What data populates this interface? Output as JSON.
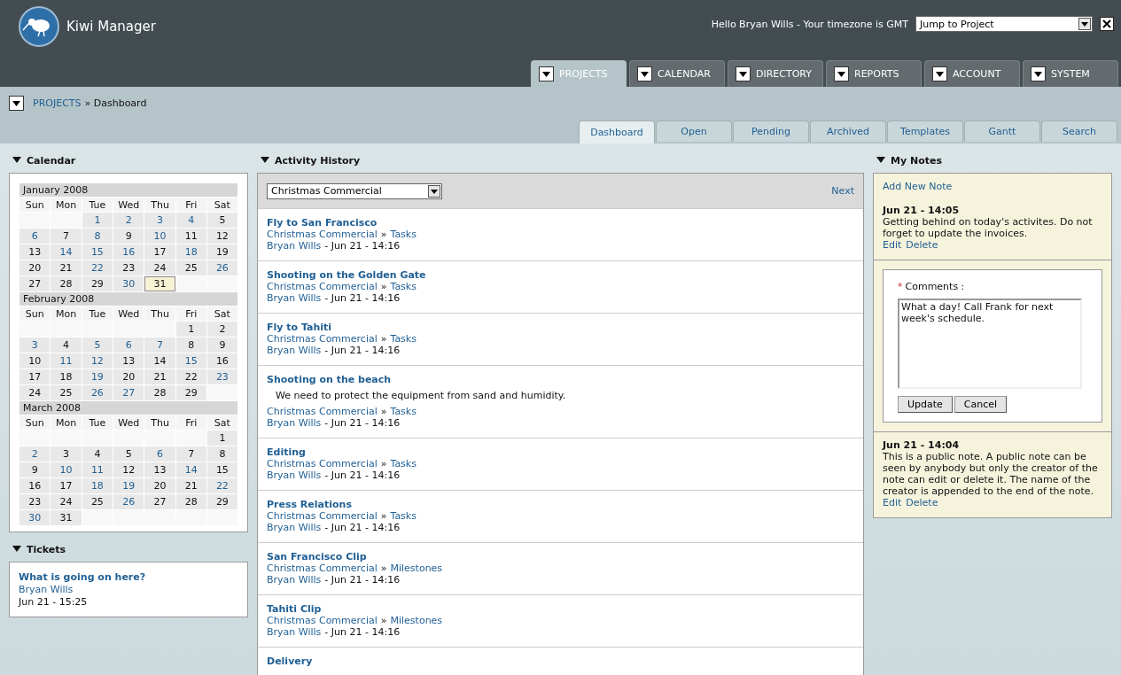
{
  "header": {
    "app_name": "Kiwi Manager",
    "greeting": "Hello Bryan Wills - Your timezone is GMT",
    "jump_select": {
      "value": "Jump to Project"
    }
  },
  "main_tabs": [
    {
      "label": "PROJECTS",
      "selected": true
    },
    {
      "label": "CALENDAR",
      "selected": false
    },
    {
      "label": "DIRECTORY",
      "selected": false
    },
    {
      "label": "REPORTS",
      "selected": false
    },
    {
      "label": "ACCOUNT",
      "selected": false
    },
    {
      "label": "SYSTEM",
      "selected": false
    }
  ],
  "breadcrumb": {
    "link": "PROJECTS",
    "current": "» Dashboard"
  },
  "sub_tabs": [
    {
      "label": "Dashboard",
      "selected": true
    },
    {
      "label": "Open",
      "selected": false
    },
    {
      "label": "Pending",
      "selected": false
    },
    {
      "label": "Archived",
      "selected": false
    },
    {
      "label": "Templates",
      "selected": false
    },
    {
      "label": "Gantt",
      "selected": false
    },
    {
      "label": "Search",
      "selected": false
    }
  ],
  "calendar": {
    "title": "Calendar",
    "months": [
      {
        "name": "January 2008",
        "weekdays": [
          "Sun",
          "Mon",
          "Tue",
          "Wed",
          "Thu",
          "Fri",
          "Sat"
        ],
        "weeks": [
          [
            {
              "kind": "empty"
            },
            {
              "kind": "empty"
            },
            {
              "kind": "day",
              "d": "1",
              "link": true,
              "selected": false
            },
            {
              "kind": "day",
              "d": "2",
              "link": true,
              "selected": false
            },
            {
              "kind": "day",
              "d": "3",
              "link": true,
              "selected": false
            },
            {
              "kind": "day",
              "d": "4",
              "link": true,
              "selected": false
            },
            {
              "kind": "day",
              "d": "5",
              "link": false,
              "selected": false
            }
          ],
          [
            {
              "kind": "day",
              "d": "6",
              "link": true,
              "selected": false
            },
            {
              "kind": "day",
              "d": "7",
              "link": false,
              "selected": false
            },
            {
              "kind": "day",
              "d": "8",
              "link": true,
              "selected": false
            },
            {
              "kind": "day",
              "d": "9",
              "link": false,
              "selected": false
            },
            {
              "kind": "day",
              "d": "10",
              "link": true,
              "selected": false
            },
            {
              "kind": "day",
              "d": "11",
              "link": false,
              "selected": false
            },
            {
              "kind": "day",
              "d": "12",
              "link": false,
              "selected": false
            }
          ],
          [
            {
              "kind": "day",
              "d": "13",
              "link": false,
              "selected": false
            },
            {
              "kind": "day",
              "d": "14",
              "link": true,
              "selected": false
            },
            {
              "kind": "day",
              "d": "15",
              "link": true,
              "selected": false
            },
            {
              "kind": "day",
              "d": "16",
              "link": true,
              "selected": false
            },
            {
              "kind": "day",
              "d": "17",
              "link": false,
              "selected": false
            },
            {
              "kind": "day",
              "d": "18",
              "link": true,
              "selected": false
            },
            {
              "kind": "day",
              "d": "19",
              "link": false,
              "selected": false
            }
          ],
          [
            {
              "kind": "day",
              "d": "20",
              "link": false,
              "selected": false
            },
            {
              "kind": "day",
              "d": "21",
              "link": false,
              "selected": false
            },
            {
              "kind": "day",
              "d": "22",
              "link": true,
              "selected": false
            },
            {
              "kind": "day",
              "d": "23",
              "link": false,
              "selected": false
            },
            {
              "kind": "day",
              "d": "24",
              "link": false,
              "selected": false
            },
            {
              "kind": "day",
              "d": "25",
              "link": false,
              "selected": false
            },
            {
              "kind": "day",
              "d": "26",
              "link": true,
              "selected": false
            }
          ],
          [
            {
              "kind": "day",
              "d": "27",
              "link": false,
              "selected": false
            },
            {
              "kind": "day",
              "d": "28",
              "link": false,
              "selected": false
            },
            {
              "kind": "day",
              "d": "29",
              "link": false,
              "selected": false
            },
            {
              "kind": "day",
              "d": "30",
              "link": true,
              "selected": false
            },
            {
              "kind": "day",
              "d": "31",
              "link": false,
              "selected": true
            },
            {
              "kind": "empty"
            },
            {
              "kind": "empty"
            }
          ]
        ]
      },
      {
        "name": "February 2008",
        "weekdays": [
          "Sun",
          "Mon",
          "Tue",
          "Wed",
          "Thu",
          "Fri",
          "Sat"
        ],
        "weeks": [
          [
            {
              "kind": "empty"
            },
            {
              "kind": "empty"
            },
            {
              "kind": "empty"
            },
            {
              "kind": "empty"
            },
            {
              "kind": "empty"
            },
            {
              "kind": "day",
              "d": "1",
              "link": false,
              "selected": false
            },
            {
              "kind": "day",
              "d": "2",
              "link": false,
              "selected": false
            }
          ],
          [
            {
              "kind": "day",
              "d": "3",
              "link": true,
              "selected": false
            },
            {
              "kind": "day",
              "d": "4",
              "link": false,
              "selected": false
            },
            {
              "kind": "day",
              "d": "5",
              "link": true,
              "selected": false
            },
            {
              "kind": "day",
              "d": "6",
              "link": true,
              "selected": false
            },
            {
              "kind": "day",
              "d": "7",
              "link": true,
              "selected": false
            },
            {
              "kind": "day",
              "d": "8",
              "link": false,
              "selected": false
            },
            {
              "kind": "day",
              "d": "9",
              "link": false,
              "selected": false
            }
          ],
          [
            {
              "kind": "day",
              "d": "10",
              "link": false,
              "selected": false
            },
            {
              "kind": "day",
              "d": "11",
              "link": true,
              "selected": false
            },
            {
              "kind": "day",
              "d": "12",
              "link": true,
              "selected": false
            },
            {
              "kind": "day",
              "d": "13",
              "link": false,
              "selected": false
            },
            {
              "kind": "day",
              "d": "14",
              "link": false,
              "selected": false
            },
            {
              "kind": "day",
              "d": "15",
              "link": true,
              "selected": false
            },
            {
              "kind": "day",
              "d": "16",
              "link": false,
              "selected": false
            }
          ],
          [
            {
              "kind": "day",
              "d": "17",
              "link": false,
              "selected": false
            },
            {
              "kind": "day",
              "d": "18",
              "link": false,
              "selected": false
            },
            {
              "kind": "day",
              "d": "19",
              "link": true,
              "selected": false
            },
            {
              "kind": "day",
              "d": "20",
              "link": false,
              "selected": false
            },
            {
              "kind": "day",
              "d": "21",
              "link": false,
              "selected": false
            },
            {
              "kind": "day",
              "d": "22",
              "link": false,
              "selected": false
            },
            {
              "kind": "day",
              "d": "23",
              "link": true,
              "selected": false
            }
          ],
          [
            {
              "kind": "day",
              "d": "24",
              "link": false,
              "selected": false
            },
            {
              "kind": "day",
              "d": "25",
              "link": false,
              "selected": false
            },
            {
              "kind": "day",
              "d": "26",
              "link": true,
              "selected": false
            },
            {
              "kind": "day",
              "d": "27",
              "link": true,
              "selected": false
            },
            {
              "kind": "day",
              "d": "28",
              "link": false,
              "selected": false
            },
            {
              "kind": "day",
              "d": "29",
              "link": false,
              "selected": false
            },
            {
              "kind": "empty"
            }
          ]
        ]
      },
      {
        "name": "March 2008",
        "weekdays": [
          "Sun",
          "Mon",
          "Tue",
          "Wed",
          "Thu",
          "Fri",
          "Sat"
        ],
        "weeks": [
          [
            {
              "kind": "empty"
            },
            {
              "kind": "empty"
            },
            {
              "kind": "empty"
            },
            {
              "kind": "empty"
            },
            {
              "kind": "empty"
            },
            {
              "kind": "empty"
            },
            {
              "kind": "day",
              "d": "1",
              "link": false,
              "selected": false
            }
          ],
          [
            {
              "kind": "day",
              "d": "2",
              "link": true,
              "selected": false
            },
            {
              "kind": "day",
              "d": "3",
              "link": false,
              "selected": false
            },
            {
              "kind": "day",
              "d": "4",
              "link": false,
              "selected": false
            },
            {
              "kind": "day",
              "d": "5",
              "link": false,
              "selected": false
            },
            {
              "kind": "day",
              "d": "6",
              "link": true,
              "selected": false
            },
            {
              "kind": "day",
              "d": "7",
              "link": false,
              "selected": false
            },
            {
              "kind": "day",
              "d": "8",
              "link": false,
              "selected": false
            }
          ],
          [
            {
              "kind": "day",
              "d": "9",
              "link": false,
              "selected": false
            },
            {
              "kind": "day",
              "d": "10",
              "link": true,
              "selected": false
            },
            {
              "kind": "day",
              "d": "11",
              "link": true,
              "selected": false
            },
            {
              "kind": "day",
              "d": "12",
              "link": false,
              "selected": false
            },
            {
              "kind": "day",
              "d": "13",
              "link": false,
              "selected": false
            },
            {
              "kind": "day",
              "d": "14",
              "link": true,
              "selected": false
            },
            {
              "kind": "day",
              "d": "15",
              "link": false,
              "selected": false
            }
          ],
          [
            {
              "kind": "day",
              "d": "16",
              "link": false,
              "selected": false
            },
            {
              "kind": "day",
              "d": "17",
              "link": false,
              "selected": false
            },
            {
              "kind": "day",
              "d": "18",
              "link": true,
              "selected": false
            },
            {
              "kind": "day",
              "d": "19",
              "link": true,
              "selected": false
            },
            {
              "kind": "day",
              "d": "20",
              "link": false,
              "selected": false
            },
            {
              "kind": "day",
              "d": "21",
              "link": false,
              "selected": false
            },
            {
              "kind": "day",
              "d": "22",
              "link": true,
              "selected": false
            }
          ],
          [
            {
              "kind": "day",
              "d": "23",
              "link": false,
              "selected": false
            },
            {
              "kind": "day",
              "d": "24",
              "link": false,
              "selected": false
            },
            {
              "kind": "day",
              "d": "25",
              "link": false,
              "selected": false
            },
            {
              "kind": "day",
              "d": "26",
              "link": true,
              "selected": false
            },
            {
              "kind": "day",
              "d": "27",
              "link": false,
              "selected": false
            },
            {
              "kind": "day",
              "d": "28",
              "link": false,
              "selected": false
            },
            {
              "kind": "day",
              "d": "29",
              "link": false,
              "selected": false
            }
          ],
          [
            {
              "kind": "day",
              "d": "30",
              "link": true,
              "selected": false
            },
            {
              "kind": "day",
              "d": "31",
              "link": false,
              "selected": false
            },
            {
              "kind": "empty"
            },
            {
              "kind": "empty"
            },
            {
              "kind": "empty"
            },
            {
              "kind": "empty"
            },
            {
              "kind": "empty"
            }
          ]
        ]
      }
    ]
  },
  "tickets": {
    "title": "Tickets",
    "items": [
      {
        "title": "What is going on here?",
        "user": "Bryan Wills",
        "time": "Jun 21 - 15:25"
      }
    ]
  },
  "activity": {
    "title": "Activity History",
    "project_select": {
      "value": "Christmas Commercial"
    },
    "next": "Next",
    "items": [
      {
        "title": "Fly to San Francisco",
        "project": "Christmas Commercial",
        "separator": "»",
        "section": "Tasks",
        "user": "Bryan Wills",
        "when": "- Jun 21 - 14:16"
      },
      {
        "title": "Shooting on the Golden Gate",
        "project": "Christmas Commercial",
        "separator": "»",
        "section": "Tasks",
        "user": "Bryan Wills",
        "when": "- Jun 21 - 14:16"
      },
      {
        "title": "Fly to Tahiti",
        "project": "Christmas Commercial",
        "separator": "»",
        "section": "Tasks",
        "user": "Bryan Wills",
        "when": "- Jun 21 - 14:16"
      },
      {
        "title": "Shooting on the beach",
        "description": "We need to protect the equipment from sand and humidity.",
        "project": "Christmas Commercial",
        "separator": "»",
        "section": "Tasks",
        "user": "Bryan Wills",
        "when": "- Jun 21 - 14:16"
      },
      {
        "title": "Editing",
        "project": "Christmas Commercial",
        "separator": "»",
        "section": "Tasks",
        "user": "Bryan Wills",
        "when": "- Jun 21 - 14:16"
      },
      {
        "title": "Press Relations",
        "project": "Christmas Commercial",
        "separator": "»",
        "section": "Tasks",
        "user": "Bryan Wills",
        "when": "- Jun 21 - 14:16"
      },
      {
        "title": "San Francisco Clip",
        "project": "Christmas Commercial",
        "separator": "»",
        "section": "Milestones",
        "user": "Bryan Wills",
        "when": "- Jun 21 - 14:16"
      },
      {
        "title": "Tahiti Clip",
        "project": "Christmas Commercial",
        "separator": "»",
        "section": "Milestones",
        "user": "Bryan Wills",
        "when": "- Jun 21 - 14:16"
      },
      {
        "title": "Delivery"
      }
    ]
  },
  "notes": {
    "title": "My Notes",
    "add_link": "Add New Note",
    "items": [
      {
        "kind": "note",
        "time": "Jun 21 - 14:05",
        "text": "Getting behind on today's activites. Do not forget to update the invoices.",
        "actions": [
          "Edit",
          "Delete"
        ]
      },
      {
        "kind": "editor",
        "required_mark": "*",
        "label": "Comments :",
        "value": "What a day! Call Frank for next week's schedule.",
        "buttons": [
          "Update",
          "Cancel"
        ]
      },
      {
        "kind": "note",
        "time": "Jun 21 - 14:04",
        "text": "This is a public note. A public note can be seen by anybody but only the creator of the note can edit or delete it. The name of the creator is appended to the end of the note.",
        "actions": [
          "Edit",
          "Delete"
        ]
      }
    ]
  }
}
